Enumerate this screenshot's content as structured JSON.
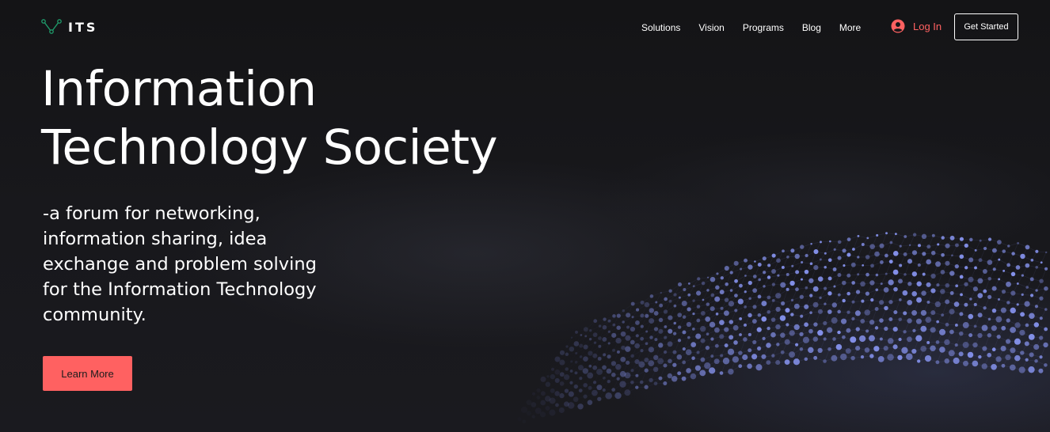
{
  "header": {
    "logo_text": "ITS",
    "logo_icon": "network-nodes-icon",
    "nav_items": [
      "Solutions",
      "Vision",
      "Programs",
      "Blog",
      "More"
    ],
    "login_label": "Log In",
    "login_icon": "user-avatar-icon",
    "cta_label": "Get Started"
  },
  "hero": {
    "title_line1": "Information",
    "title_line2": "Technology Society",
    "subtitle": "-a forum for networking, information sharing, idea exchange and problem solving for the Information Technology community.",
    "button_label": "Learn More"
  },
  "colors": {
    "background": "#151518",
    "accent": "#ff6161",
    "logo_green": "#1f9a6a",
    "text": "#ffffff",
    "particles": "#8f9dff"
  }
}
